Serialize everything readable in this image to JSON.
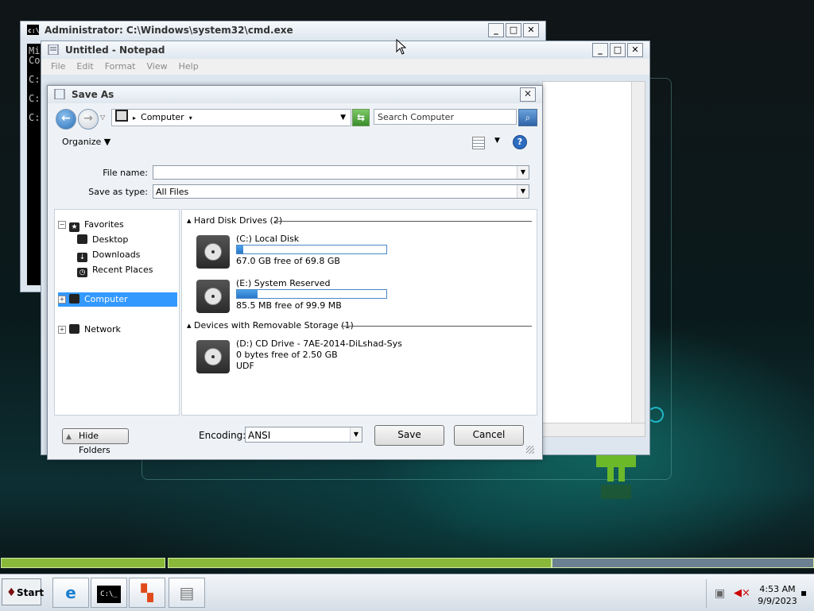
{
  "cmd": {
    "title": "Administrator: C:\\Windows\\system32\\cmd.exe",
    "lines": [
      "Mi",
      "Co",
      "",
      "C:",
      "",
      "C:",
      "",
      "C:"
    ]
  },
  "notepad": {
    "title": "Untitled - Notepad",
    "menu": [
      "File",
      "Edit",
      "Format",
      "View",
      "Help"
    ]
  },
  "dialog": {
    "title": "Save As",
    "address": "Computer",
    "search_placeholder": "Search Computer",
    "organize": "Organize",
    "file_name_label": "File name:",
    "file_name_value": "",
    "save_as_type_label": "Save as type:",
    "save_as_type_value": "All Files",
    "nav": {
      "favorites": "Favorites",
      "desktop": "Desktop",
      "downloads": "Downloads",
      "recent": "Recent Places",
      "computer": "Computer",
      "network": "Network"
    },
    "groups": {
      "hdd": "Hard Disk Drives (2)",
      "removable": "Devices with Removable Storage (1)"
    },
    "drives": [
      {
        "name": "(C:) Local Disk",
        "free": "67.0 GB free of 69.8 GB",
        "used_fraction": 0.04
      },
      {
        "name": "(E:) System Reserved",
        "free": "85.5 MB free of 99.9 MB",
        "used_fraction": 0.14
      },
      {
        "name": "(D:) CD Drive - 7AE-2014-DiLshad-Sys",
        "free": "0 bytes free of 2.50 GB",
        "fs": "UDF"
      }
    ],
    "hide_folders": "Hide Folders",
    "encoding_label": "Encoding:",
    "encoding_value": "ANSI",
    "save": "Save",
    "cancel": "Cancel"
  },
  "taskbar": {
    "start": "Start",
    "time": "4:53 AM",
    "date": "9/9/2023"
  },
  "colors": {
    "selection": "#3399ff",
    "progress": "#2a77c9",
    "taskbar_accent": "#8ab93a"
  }
}
